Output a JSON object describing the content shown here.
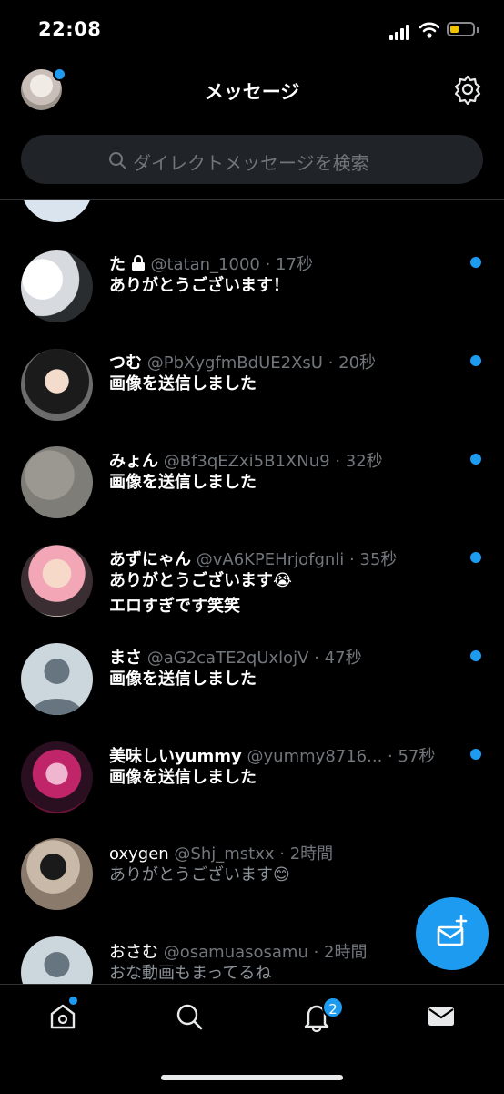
{
  "status_bar": {
    "time": "22:08"
  },
  "header": {
    "title": "メッセージ"
  },
  "search": {
    "placeholder": "ダイレクトメッセージを検索"
  },
  "conversations": [
    {
      "name": "た",
      "locked": true,
      "handle": "@tatan_1000",
      "time": "· 17秒",
      "message": "ありがとうございます！",
      "unread": true
    },
    {
      "name": "つむ",
      "handle": "@PbXygfmBdUE2XsU",
      "time": "· 20秒",
      "message": "画像を送信しました",
      "unread": true
    },
    {
      "name": "みょん",
      "handle": "@Bf3qEZxi5B1XNu9",
      "time": "· 32秒",
      "message": "画像を送信しました",
      "unread": true
    },
    {
      "name": "あずにゃん",
      "handle": "@vA6KPEHrjofgnli",
      "time": "· 35秒",
      "message": "ありがとうございます😭",
      "message2": "エロすぎです笑笑",
      "unread": true
    },
    {
      "name": "まさ",
      "handle": "@aG2caTE2qUxlojV",
      "time": "· 47秒",
      "message": "画像を送信しました",
      "unread": true
    },
    {
      "name": "美味しいyummy",
      "handle": "@yummy8716...",
      "time": "· 57秒",
      "message": "画像を送信しました",
      "unread": true
    },
    {
      "name": "oxygen",
      "handle": "@Shj_mstxx",
      "time": "· 2時間",
      "message": "ありがとうございます😊",
      "unread": false
    },
    {
      "name": "おさむ",
      "handle": "@osamuasosamu",
      "time": "· 2時間",
      "message": "おな動画もまってるね",
      "unread": false
    }
  ],
  "tabbar": {
    "notifications_badge": "2"
  },
  "colors": {
    "accent": "#1d9bf0",
    "background": "#000000",
    "muted": "#71767b"
  },
  "icons": [
    "search-icon",
    "gear-icon",
    "lock-icon",
    "home-icon",
    "explore-icon",
    "bell-icon",
    "mail-icon",
    "compose-mail-icon"
  ]
}
